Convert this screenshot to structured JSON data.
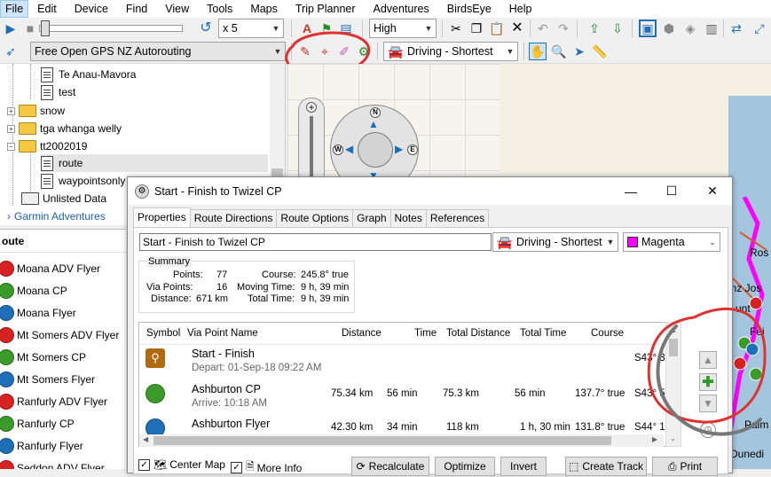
{
  "menu": [
    "File",
    "Edit",
    "Device",
    "Find",
    "View",
    "Tools",
    "Maps",
    "Trip Planner",
    "Adventures",
    "BirdsEye",
    "Help"
  ],
  "toolbar": {
    "speed_value": "x 5",
    "quality_value": "High",
    "map_product": "Free Open GPS NZ Autorouting",
    "route_mode": "Driving - Shortest"
  },
  "tree": {
    "items": [
      "Te Anau-Mavora",
      "test",
      "snow",
      "tga whanga welly",
      "tt2002019",
      "route",
      "waypointsonly",
      "Unlisted Data"
    ],
    "garmin": "Garmin Adventures"
  },
  "route_list": {
    "header": "oute",
    "items": [
      {
        "label": "Moana ADV Flyer",
        "color": "#d72222"
      },
      {
        "label": "Moana CP",
        "color": "#3a9a2a"
      },
      {
        "label": "Moana Flyer",
        "color": "#1e6fb8"
      },
      {
        "label": "Mt Somers ADV Flyer",
        "color": "#d72222"
      },
      {
        "label": "Mt Somers CP",
        "color": "#3a9a2a"
      },
      {
        "label": "Mt Somers Flyer",
        "color": "#1e6fb8"
      },
      {
        "label": "Ranfurly ADV Flyer",
        "color": "#d72222"
      },
      {
        "label": "Ranfurly CP",
        "color": "#3a9a2a"
      },
      {
        "label": "Ranfurly Flyer",
        "color": "#1e6fb8"
      },
      {
        "label": "Seddon ADV Flyer",
        "color": "#d72222"
      }
    ]
  },
  "map": {
    "compass_n": "N",
    "compass_w": "W",
    "compass_e": "E",
    "labels": [
      "Ros",
      "anz Jos",
      "unt",
      "Fei",
      "Palm",
      "Dunedi"
    ]
  },
  "dialog": {
    "title": "Start - Finish to Twizel CP",
    "tabs": [
      "Properties",
      "Route Directions",
      "Route Options",
      "Graph",
      "Notes",
      "References"
    ],
    "name_value": "Start - Finish to Twizel CP",
    "route_mode": "Driving - Shortest",
    "color_value": "Magenta",
    "summary": {
      "title": "Summary",
      "points_label": "Points:",
      "points_value": "77",
      "via_label": "Via Points:",
      "via_value": "16",
      "distance_label": "Distance:",
      "distance_value": "671 km",
      "course_label": "Course:",
      "course_value": "245.8° true",
      "moving_label": "Moving Time:",
      "moving_value": "9 h, 39 min",
      "total_label": "Total Time:",
      "total_value": "9 h, 39 min"
    },
    "columns": [
      "Symbol",
      "Via Point Name",
      "Distance",
      "Time",
      "Total Distance",
      "Total Time",
      "Course"
    ],
    "rows": [
      {
        "name": "Start - Finish",
        "sub": "Depart: 01-Sep-18 09:22 AM",
        "distance": "",
        "time": "",
        "total_distance": "",
        "total_time": "",
        "course": "",
        "pos": "S43° 30.7"
      },
      {
        "name": "Ashburton CP",
        "sub": "Arrive: 10:18 AM",
        "distance": "75.34 km",
        "time": "56 min",
        "total_distance": "75.3 km",
        "total_time": "56 min",
        "course": "137.7° true",
        "pos": "S43° 53.4"
      },
      {
        "name": "Ashburton Flyer",
        "sub": "",
        "distance": "42.30 km",
        "time": "34 min",
        "total_distance": "118 km",
        "total_time": "1 h, 30 min",
        "course": "131.8° true",
        "pos": "S44° 10.7"
      }
    ],
    "buttons": {
      "center_map": "Center Map",
      "more_info": "More Info",
      "recalculate": "Recalculate",
      "optimize": "Optimize",
      "invert": "Invert",
      "create_track": "Create Track",
      "print": "Print"
    }
  },
  "colors": {
    "accent": "#0078d7",
    "magenta": "#ff00ff",
    "annotation": "#e03030"
  }
}
